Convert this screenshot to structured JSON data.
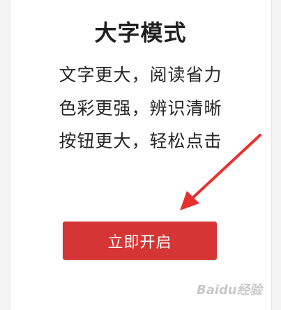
{
  "mode": {
    "title": "大字模式",
    "features": [
      "文字更大，阅读省力",
      "色彩更强，辨识清晰",
      "按钮更大，轻松点击"
    ],
    "enable_button_label": "立即开启"
  },
  "colors": {
    "button": "#d63535",
    "arrow": "#e8312f"
  },
  "watermark": {
    "text": "Baidu经验"
  }
}
